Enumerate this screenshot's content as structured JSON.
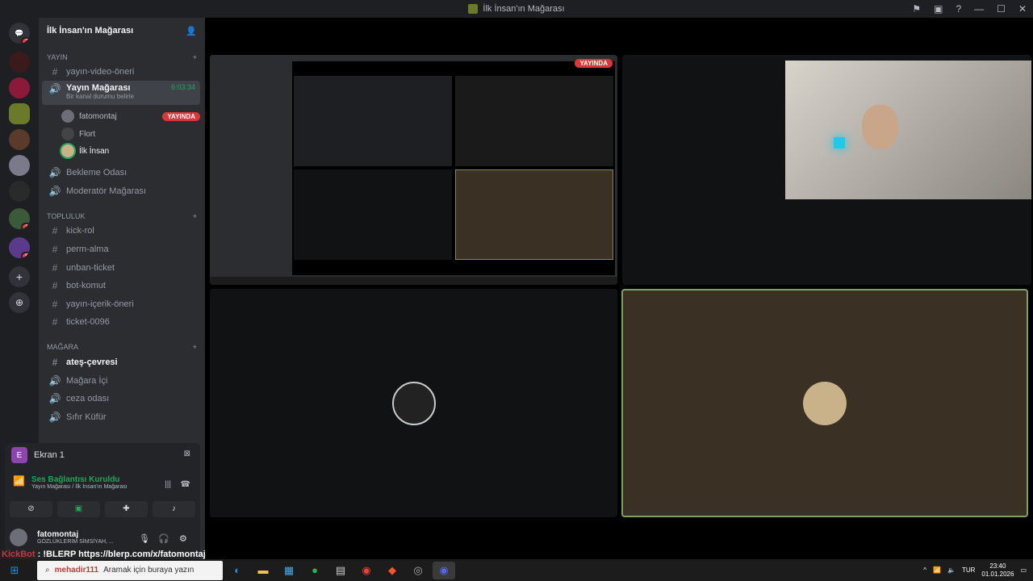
{
  "window": {
    "title": "İlk İnsan'ın Mağarası"
  },
  "server": {
    "name": "İlk İnsan'ın Mağarası"
  },
  "categories": {
    "yayin": "YAYIN",
    "topluluk": "TOPLULUK",
    "magara": "MAĞARA"
  },
  "channels": {
    "yayin_video": "yayın-video-öneri",
    "yayin_magarasi": "Yayın Mağarası",
    "yayin_magarasi_status": "Bir kanal durumu belirle",
    "yayin_timer": "6:03:34",
    "bekleme": "Bekleme Odası",
    "moderator": "Moderatör Mağarası",
    "kick_rol": "kick-rol",
    "perm_alma": "perm-alma",
    "unban": "unban-ticket",
    "bot_komut": "bot-komut",
    "yayin_icerik": "yayın-içerik-öneri",
    "ticket": "ticket-0096",
    "ates": "ateş-çevresi",
    "magara_ici": "Mağara İçi",
    "ceza": "ceza odası",
    "sifir": "Sıfır Küfür"
  },
  "voice_users": [
    {
      "name": "fatomontaj",
      "badge": "YAYINDA"
    },
    {
      "name": "Flort"
    },
    {
      "name": "İlk İnsan"
    }
  ],
  "panel": {
    "screen_label": "Ekran 1",
    "connection": "Ses Bağlantısı Kuruldu",
    "connection_sub": "Yayın Mağarası / İlk İnsan'ın Mağarası",
    "user": "fatomontaj",
    "user_status": "GÖZLÜKLERİM SİMSİYAH, ..."
  },
  "stream": {
    "live_badge": "YAYINDA"
  },
  "overlay": {
    "name": "KickBot",
    "text": ": !BLERP https://blerp.com/x/fatomontaj",
    "user": "mehadir111"
  },
  "taskbar": {
    "search_placeholder": "Aramak için buraya yazın",
    "lang": "TUR",
    "time": "23:40",
    "date": "01.01.2026"
  },
  "guild_badges": [
    "2",
    "1",
    "8"
  ]
}
